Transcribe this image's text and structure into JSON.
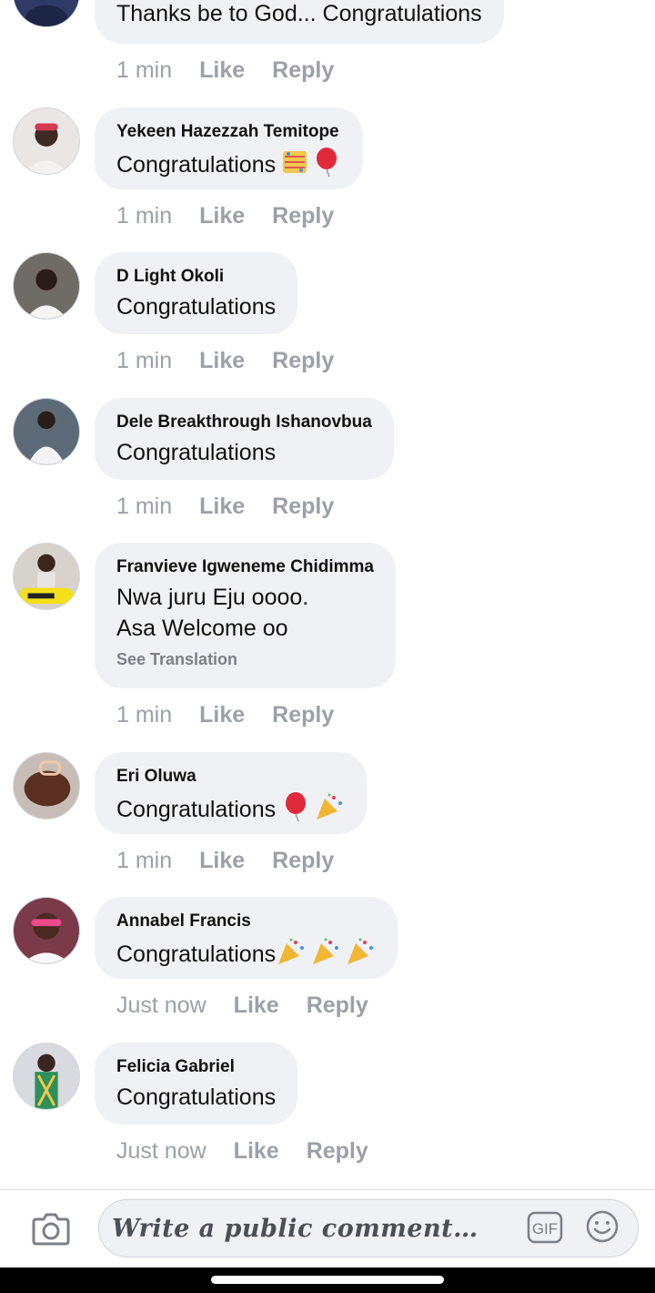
{
  "comments": [
    {
      "author": "",
      "text": "Thanks be to God... Congratulations",
      "time": "1 min",
      "like_label": "Like",
      "reply_label": "Reply",
      "emojis": []
    },
    {
      "author": "Yekeen Hazezzah Temitope",
      "text": "Congratulations",
      "time": "1 min",
      "like_label": "Like",
      "reply_label": "Reply",
      "emojis": [
        "confetti-emoji",
        "balloon-emoji"
      ]
    },
    {
      "author": "D Light Okoli",
      "text": "Congratulations",
      "time": "1 min",
      "like_label": "Like",
      "reply_label": "Reply",
      "emojis": []
    },
    {
      "author": "Dele Breakthrough Ishanovbua",
      "text": "Congratulations",
      "time": "1 min",
      "like_label": "Like",
      "reply_label": "Reply",
      "emojis": []
    },
    {
      "author": "Franvieve Igweneme Chidimma",
      "text_lines": [
        "Nwa juru Eju oooo.",
        "Asa Welcome oo"
      ],
      "see_translation": "See Translation",
      "time": "1 min",
      "like_label": "Like",
      "reply_label": "Reply",
      "emojis": []
    },
    {
      "author": "Eri Oluwa",
      "text": "Congratulations",
      "time": "1 min",
      "like_label": "Like",
      "reply_label": "Reply",
      "emojis": [
        "balloon-emoji",
        "party-popper-emoji"
      ]
    },
    {
      "author": "Annabel Francis",
      "text": "Congratulations",
      "time": "Just now",
      "like_label": "Like",
      "reply_label": "Reply",
      "emojis": [
        "party-popper-emoji",
        "party-popper-emoji",
        "party-popper-emoji"
      ]
    },
    {
      "author": "Felicia Gabriel",
      "text": "Congratulations",
      "time": "Just now",
      "like_label": "Like",
      "reply_label": "Reply",
      "emojis": []
    }
  ],
  "composer": {
    "placeholder": "Write a public comment…",
    "camera_icon": "camera-icon",
    "gif_label": "GIF",
    "emoji_icon": "smiley-icon"
  },
  "colors": {
    "bubble": "#f0f1f5",
    "meta_text": "#9ca0a7",
    "author_text": "#111111"
  }
}
